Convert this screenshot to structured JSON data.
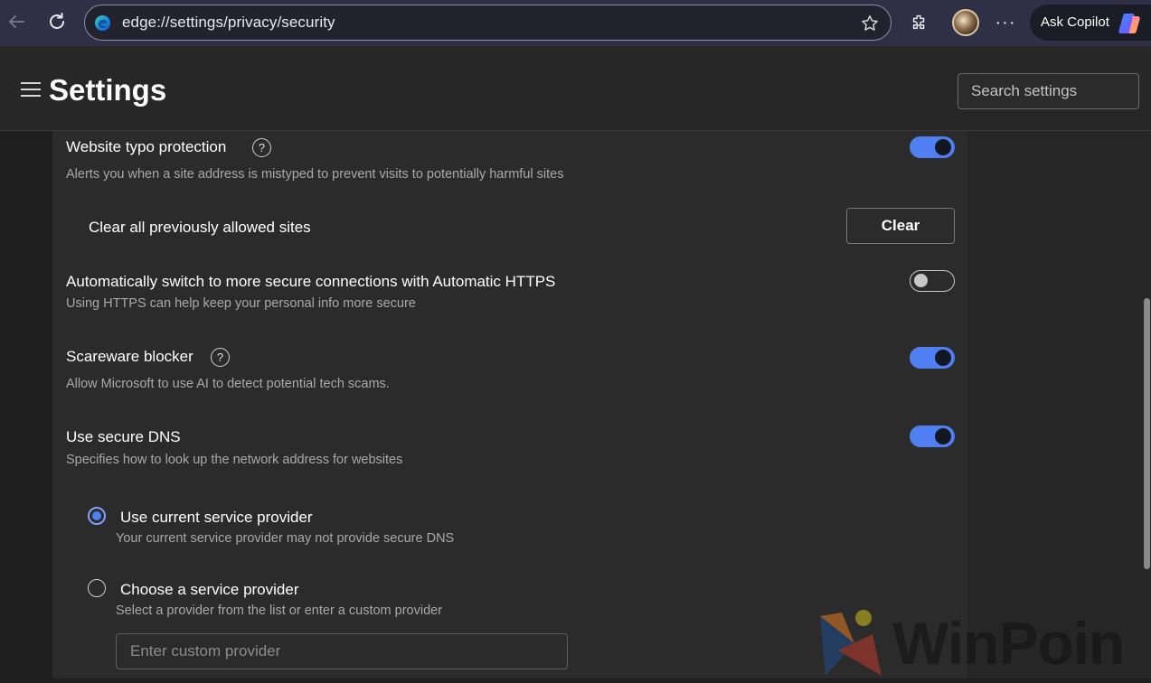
{
  "browser": {
    "url": "edge://settings/privacy/security",
    "copilot_label": "Ask Copilot"
  },
  "header": {
    "title": "Settings",
    "search_placeholder": "Search settings"
  },
  "settings": {
    "typo": {
      "title": "Website typo protection",
      "desc": "Alerts you when a site address is mistyped to prevent visits to potentially harmful sites",
      "enabled": true
    },
    "clear_sites": {
      "label": "Clear all previously allowed sites",
      "button": "Clear"
    },
    "https": {
      "title": "Automatically switch to more secure connections with Automatic HTTPS",
      "desc": "Using HTTPS can help keep your personal info more secure",
      "enabled": false
    },
    "scareware": {
      "title": "Scareware blocker",
      "desc": "Allow Microsoft to use AI to detect potential tech scams.",
      "enabled": true
    },
    "dns": {
      "title": "Use secure DNS",
      "desc": "Specifies how to look up the network address for websites",
      "enabled": true,
      "options": [
        {
          "label": "Use current service provider",
          "desc": "Your current service provider may not provide secure DNS",
          "selected": true
        },
        {
          "label": "Choose a service provider",
          "desc": "Select a provider from the list or enter a custom provider",
          "selected": false
        }
      ],
      "custom_placeholder": "Enter custom provider"
    }
  },
  "watermark": {
    "text": "WinPoin"
  },
  "colors": {
    "accent": "#4f7ff0",
    "toolbar": "#2f3046",
    "background": "#1f1f1f"
  }
}
